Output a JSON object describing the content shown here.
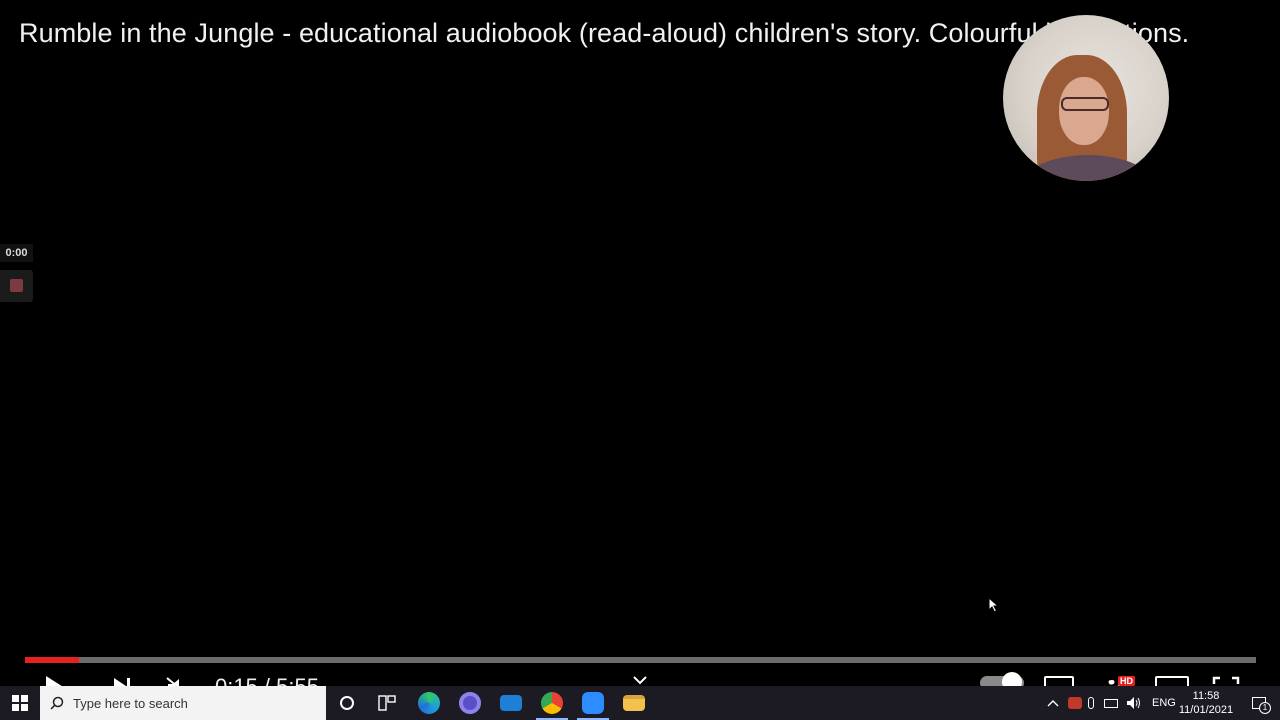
{
  "video": {
    "title": "Rumble in the Jungle - educational audiobook (read-aloud) children's story. Colourful illustrations.",
    "hover_time": "0:00",
    "time_display": "0:15 / 5:55",
    "progress": 0.044,
    "accent_color": "#e52222"
  },
  "controls": {
    "settings_badge": "HD",
    "icons": [
      "play-icon",
      "next-icon",
      "mute-icon",
      "chapter-chevron-icon",
      "autoplay-toggle",
      "subtitles-icon",
      "settings-icon",
      "theater-icon",
      "fullscreen-icon"
    ]
  },
  "taskbar": {
    "search_placeholder": "Type here to search",
    "apps": [
      {
        "name": "edge",
        "icon": "edge-icon",
        "color": "#1fa0d8"
      },
      {
        "name": "app-purple",
        "icon": "snowflake-app-icon",
        "color": "#5b4fc9"
      },
      {
        "name": "mail",
        "icon": "mail-icon",
        "color": "#1e7fd6"
      },
      {
        "name": "chrome",
        "icon": "chrome-icon",
        "color": "#e9a620"
      },
      {
        "name": "zoom",
        "icon": "zoom-icon",
        "color": "#2d8cff"
      },
      {
        "name": "file-explorer",
        "icon": "folder-icon",
        "color": "#f2c14e"
      }
    ],
    "language": "ENG",
    "time": "11:58",
    "date": "11/01/2021",
    "notification_count": "1"
  }
}
